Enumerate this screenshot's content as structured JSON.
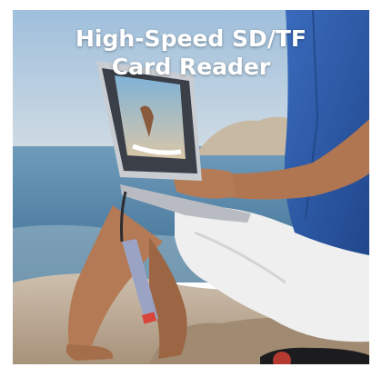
{
  "headline": {
    "line1": "High-Speed SD/TF",
    "line2": "Card Reader"
  },
  "scene": {
    "subject": "man-with-laptop",
    "colors": {
      "sky": "#b7cfe3",
      "sea": "#5d8fb0",
      "sand": "#c9b8a2",
      "shirt": "#2f5aa8",
      "shorts": "#eeeeee",
      "skin": "#b8805c",
      "laptop": "#c9ccd1",
      "hub": "#9aa3c4"
    }
  }
}
